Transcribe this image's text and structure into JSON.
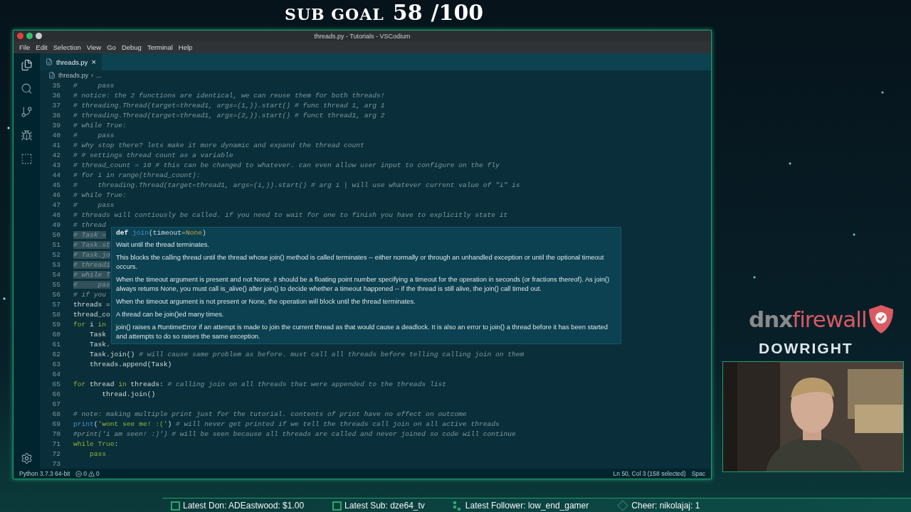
{
  "sub_goal": {
    "label": "SUB GOAL",
    "count": "58",
    "target": "/100"
  },
  "window": {
    "title": "threads.py - Tutorials - VSCodium",
    "menu": [
      "File",
      "Edit",
      "Selection",
      "View",
      "Go",
      "Debug",
      "Terminal",
      "Help"
    ],
    "tabs": [
      {
        "label": "threads.py",
        "selected": true,
        "close": "×"
      }
    ],
    "breadcrumb": {
      "file": "threads.py",
      "separator": "›",
      "rest": "..."
    },
    "lines": [
      {
        "number": "35",
        "selected": false,
        "tokens": [
          {
            "kind": "comment",
            "text": "#     pass"
          }
        ]
      },
      {
        "number": "36",
        "selected": false,
        "tokens": [
          {
            "kind": "comment",
            "text": "# notice: the 2 functions are identical, we can reuse them for both threads!"
          }
        ]
      },
      {
        "number": "37",
        "selected": false,
        "tokens": [
          {
            "kind": "comment",
            "text": "# threading.Thread(target=thread1, args=(1,)).start() # func thread 1, arg 1"
          }
        ]
      },
      {
        "number": "38",
        "selected": false,
        "tokens": [
          {
            "kind": "comment",
            "text": "# threading.Thread(target=thread1, args=(2,)).start() # funct thread1, arg 2"
          }
        ]
      },
      {
        "number": "39",
        "selected": false,
        "tokens": [
          {
            "kind": "comment",
            "text": "# while True:"
          }
        ]
      },
      {
        "number": "40",
        "selected": false,
        "tokens": [
          {
            "kind": "comment",
            "text": "#     pass"
          }
        ]
      },
      {
        "number": "41",
        "selected": false,
        "tokens": [
          {
            "kind": "comment",
            "text": "# why stop there? lets make it more dynamic and expand the thread count"
          }
        ]
      },
      {
        "number": "42",
        "selected": false,
        "tokens": [
          {
            "kind": "comment",
            "text": "# # settings thread count as a variable"
          }
        ]
      },
      {
        "number": "43",
        "selected": false,
        "tokens": [
          {
            "kind": "comment",
            "text": "# thread_count = 10 # this can be changed to whatever. can even allow user input to configure on the fly"
          }
        ]
      },
      {
        "number": "44",
        "selected": false,
        "tokens": [
          {
            "kind": "comment",
            "text": "# for i in range(thread_count):"
          }
        ]
      },
      {
        "number": "45",
        "selected": false,
        "tokens": [
          {
            "kind": "comment",
            "text": "#     threading.Thread(target=thread1, args=(i,)).start() # arg i | will use whatever current value of \"i\" is"
          }
        ]
      },
      {
        "number": "46",
        "selected": false,
        "tokens": [
          {
            "kind": "comment",
            "text": "# while True:"
          }
        ]
      },
      {
        "number": "47",
        "selected": false,
        "tokens": [
          {
            "kind": "comment",
            "text": "#     pass"
          }
        ]
      },
      {
        "number": "48",
        "selected": false,
        "tokens": [
          {
            "kind": "comment",
            "text": "# threads will contiously be called. if you need to wait for one to finish you have to explicitly state it"
          }
        ]
      },
      {
        "number": "49",
        "selected": false,
        "tokens": [
          {
            "kind": "comment",
            "text": "# thread"
          }
        ]
      },
      {
        "number": "50",
        "selected": true,
        "tokens": [
          {
            "kind": "comment",
            "text": "# Task ="
          }
        ]
      },
      {
        "number": "51",
        "selected": true,
        "tokens": [
          {
            "kind": "comment",
            "text": "# Task.st"
          }
        ]
      },
      {
        "number": "52",
        "selected": true,
        "tokens": [
          {
            "kind": "comment",
            "text": "# Task.jo"
          }
        ]
      },
      {
        "number": "53",
        "selected": true,
        "tokens": [
          {
            "kind": "comment",
            "text": "# threadi"
          }
        ]
      },
      {
        "number": "54",
        "selected": true,
        "tokens": [
          {
            "kind": "comment",
            "text": "# while T"
          }
        ]
      },
      {
        "number": "55",
        "selected": true,
        "tokens": [
          {
            "kind": "comment",
            "text": "#     pas"
          }
        ]
      },
      {
        "number": "56",
        "selected": false,
        "tokens": [
          {
            "kind": "comment",
            "text": "# if you"
          }
        ]
      },
      {
        "number": "57",
        "selected": false,
        "tokens": [
          {
            "kind": "plain",
            "text": "threads ="
          }
        ]
      },
      {
        "number": "58",
        "selected": false,
        "tokens": [
          {
            "kind": "plain",
            "text": "thread_co"
          }
        ]
      },
      {
        "number": "59",
        "selected": false,
        "tokens": [
          {
            "kind": "keyword",
            "text": "for"
          },
          {
            "kind": "plain",
            "text": " i "
          },
          {
            "kind": "keyword",
            "text": "in"
          }
        ]
      },
      {
        "number": "60",
        "selected": false,
        "tokens": [
          {
            "kind": "plain",
            "text": "    Task"
          }
        ]
      },
      {
        "number": "61",
        "selected": false,
        "tokens": [
          {
            "kind": "plain",
            "text": "    Task."
          }
        ]
      },
      {
        "number": "62",
        "selected": false,
        "tokens": [
          {
            "kind": "plain",
            "text": "    Task.join() "
          },
          {
            "kind": "comment",
            "text": "# will cause same problem as before. must call all threads before telling calling join on them"
          }
        ]
      },
      {
        "number": "63",
        "selected": false,
        "tokens": [
          {
            "kind": "plain",
            "text": "    threads.append(Task)"
          }
        ]
      },
      {
        "number": "64"
      },
      {
        "number": "65",
        "selected": false,
        "tokens": [
          {
            "kind": "keyword",
            "text": "for"
          },
          {
            "kind": "plain",
            "text": " thread "
          },
          {
            "kind": "keyword",
            "text": "in"
          },
          {
            "kind": "plain",
            "text": " threads: "
          },
          {
            "kind": "comment",
            "text": "# calling join on all threads that were appended to the threads list"
          }
        ]
      },
      {
        "number": "66",
        "selected": false,
        "tokens": [
          {
            "kind": "plain",
            "text": "       thread.join()"
          }
        ]
      },
      {
        "number": "67"
      },
      {
        "number": "68",
        "selected": false,
        "tokens": [
          {
            "kind": "comment",
            "text": "# note: making multiple print just for the tutorial. contents of print have no effect on outcome"
          }
        ]
      },
      {
        "number": "69",
        "selected": false,
        "tokens": [
          {
            "kind": "function",
            "text": "print"
          },
          {
            "kind": "plain",
            "text": "("
          },
          {
            "kind": "string",
            "text": "'wont see me! :('"
          },
          {
            "kind": "plain",
            "text": ") "
          },
          {
            "kind": "comment",
            "text": "# will never get printed if we tell the threads call join on all active threads"
          }
        ]
      },
      {
        "number": "70",
        "selected": false,
        "tokens": [
          {
            "kind": "comment",
            "text": "#print('i am seen! :)') # will be seen because all threads are called and never joined so code will continue"
          }
        ]
      },
      {
        "number": "71",
        "selected": false,
        "tokens": [
          {
            "kind": "keyword",
            "text": "while True"
          },
          {
            "kind": "plain",
            "text": ":"
          }
        ]
      },
      {
        "number": "72",
        "selected": false,
        "tokens": [
          {
            "kind": "keyword",
            "text": "    pass"
          }
        ]
      },
      {
        "number": "73"
      }
    ],
    "tooltip": {
      "signature": [
        {
          "kind": "bold",
          "text": "def "
        },
        {
          "kind": "function",
          "text": "join"
        },
        {
          "kind": "plain",
          "text": "(timeout="
        },
        {
          "kind": "constant",
          "text": "None"
        },
        {
          "kind": "plain",
          "text": ")"
        }
      ],
      "paragraphs": [
        "Wait until the thread terminates.",
        "This blocks the calling thread until the thread whose join() method is called terminates -- either normally or through an unhandled exception or until the optional timeout occurs.",
        "When the timeout argument is present and not None, it should be a floating point number specifying a timeout for the operation in seconds (or fractions thereof). As join() always returns None, you must call is_alive() after join() to decide whether a timeout happened -- if the thread is still alive, the join() call timed out.",
        "When the timeout argument is not present or None, the operation will block until the thread terminates.",
        "A thread can be join()ed many times.",
        "join() raises a RuntimeError if an attempt is made to join the current thread as that would cause a deadlock. It is also an error to join() a thread before it has been started and attempts to do so raises the same exception."
      ]
    },
    "status_bar": {
      "interpreter": "Python 3.7.3 64-bit",
      "errors": "0",
      "warnings": "0",
      "position": "Ln 50, Col 3 (158 selected)",
      "indent": "Spac"
    }
  },
  "brand": {
    "part_1": "dnx",
    "part_2": "firewall",
    "streamer": "DOWRIGHT"
  },
  "ticker": [
    {
      "kind": "box",
      "label": "Latest Don: ADEastwood: $1.00"
    },
    {
      "kind": "box",
      "label": "Latest Sub: dze64_tv"
    },
    {
      "kind": "dots",
      "label": "Latest Follower: low_end_gamer"
    },
    {
      "kind": "gem",
      "label": "Cheer: nikolajaj: 1"
    }
  ]
}
